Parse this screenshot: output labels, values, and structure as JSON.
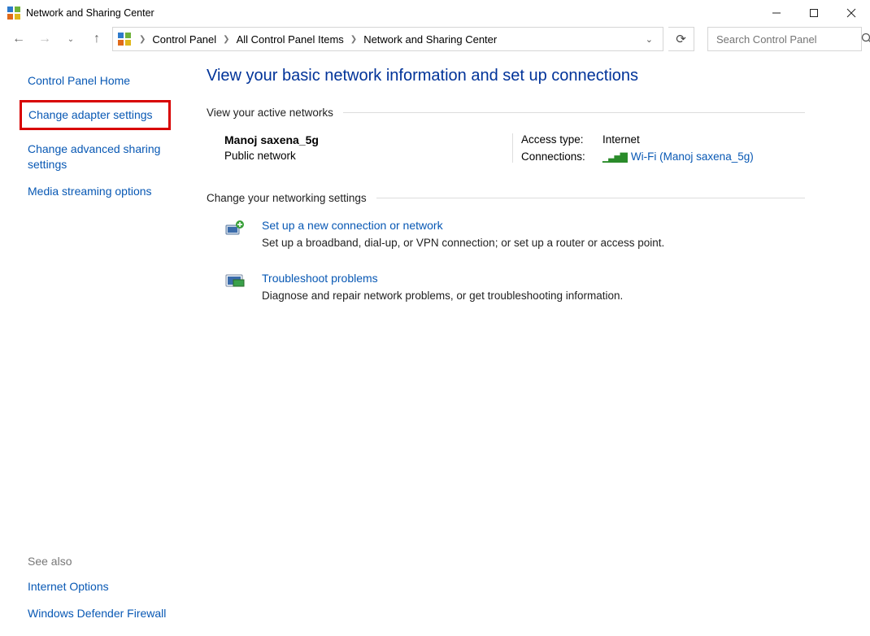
{
  "window": {
    "title": "Network and Sharing Center"
  },
  "breadcrumb": {
    "items": [
      "Control Panel",
      "All Control Panel Items",
      "Network and Sharing Center"
    ]
  },
  "search": {
    "placeholder": "Search Control Panel"
  },
  "sidebar": {
    "items": [
      {
        "label": "Control Panel Home"
      },
      {
        "label": "Change adapter settings"
      },
      {
        "label": "Change advanced sharing settings"
      },
      {
        "label": "Media streaming options"
      }
    ],
    "see_also_heading": "See also",
    "see_also": [
      {
        "label": "Internet Options"
      },
      {
        "label": "Windows Defender Firewall"
      }
    ]
  },
  "main": {
    "heading": "View your basic network information and set up connections",
    "active_networks_title": "View your active networks",
    "network": {
      "name": "Manoj saxena_5g",
      "profile": "Public network",
      "access_type_label": "Access type:",
      "access_type_value": "Internet",
      "connections_label": "Connections:",
      "connection_link": "Wi-Fi (Manoj saxena_5g)"
    },
    "change_settings_title": "Change your networking settings",
    "settings": [
      {
        "title": "Set up a new connection or network",
        "desc": "Set up a broadband, dial-up, or VPN connection; or set up a router or access point."
      },
      {
        "title": "Troubleshoot problems",
        "desc": "Diagnose and repair network problems, or get troubleshooting information."
      }
    ]
  }
}
